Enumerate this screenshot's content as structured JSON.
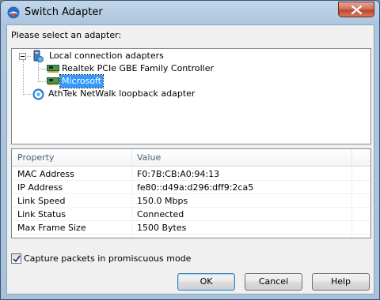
{
  "window": {
    "title": "Switch Adapter"
  },
  "prompt": "Please select an adapter:",
  "tree": {
    "root_label": "Local connection adapters",
    "children": [
      {
        "label": "Realtek PCIe GBE Family Controller",
        "icon": "network-card-icon"
      },
      {
        "label": "Microsoft",
        "icon": "network-card-icon",
        "selected": true
      }
    ],
    "loopback_label": "AthTek NetWalk loopback adapter"
  },
  "properties": {
    "headers": [
      "Property",
      "Value"
    ],
    "rows": [
      {
        "property": "MAC Address",
        "value": "F0:7B:CB:A0:94:13"
      },
      {
        "property": "IP Address",
        "value": "fe80::d49a:d296:dff9:2ca5"
      },
      {
        "property": "Link Speed",
        "value": "150.0 Mbps"
      },
      {
        "property": "Link Status",
        "value": "Connected"
      },
      {
        "property": "Max Frame Size",
        "value": "1500 Bytes"
      }
    ]
  },
  "promiscuous": {
    "label": "Capture packets in promiscuous mode",
    "checked": true
  },
  "buttons": {
    "ok": "OK",
    "cancel": "Cancel",
    "help": "Help"
  }
}
